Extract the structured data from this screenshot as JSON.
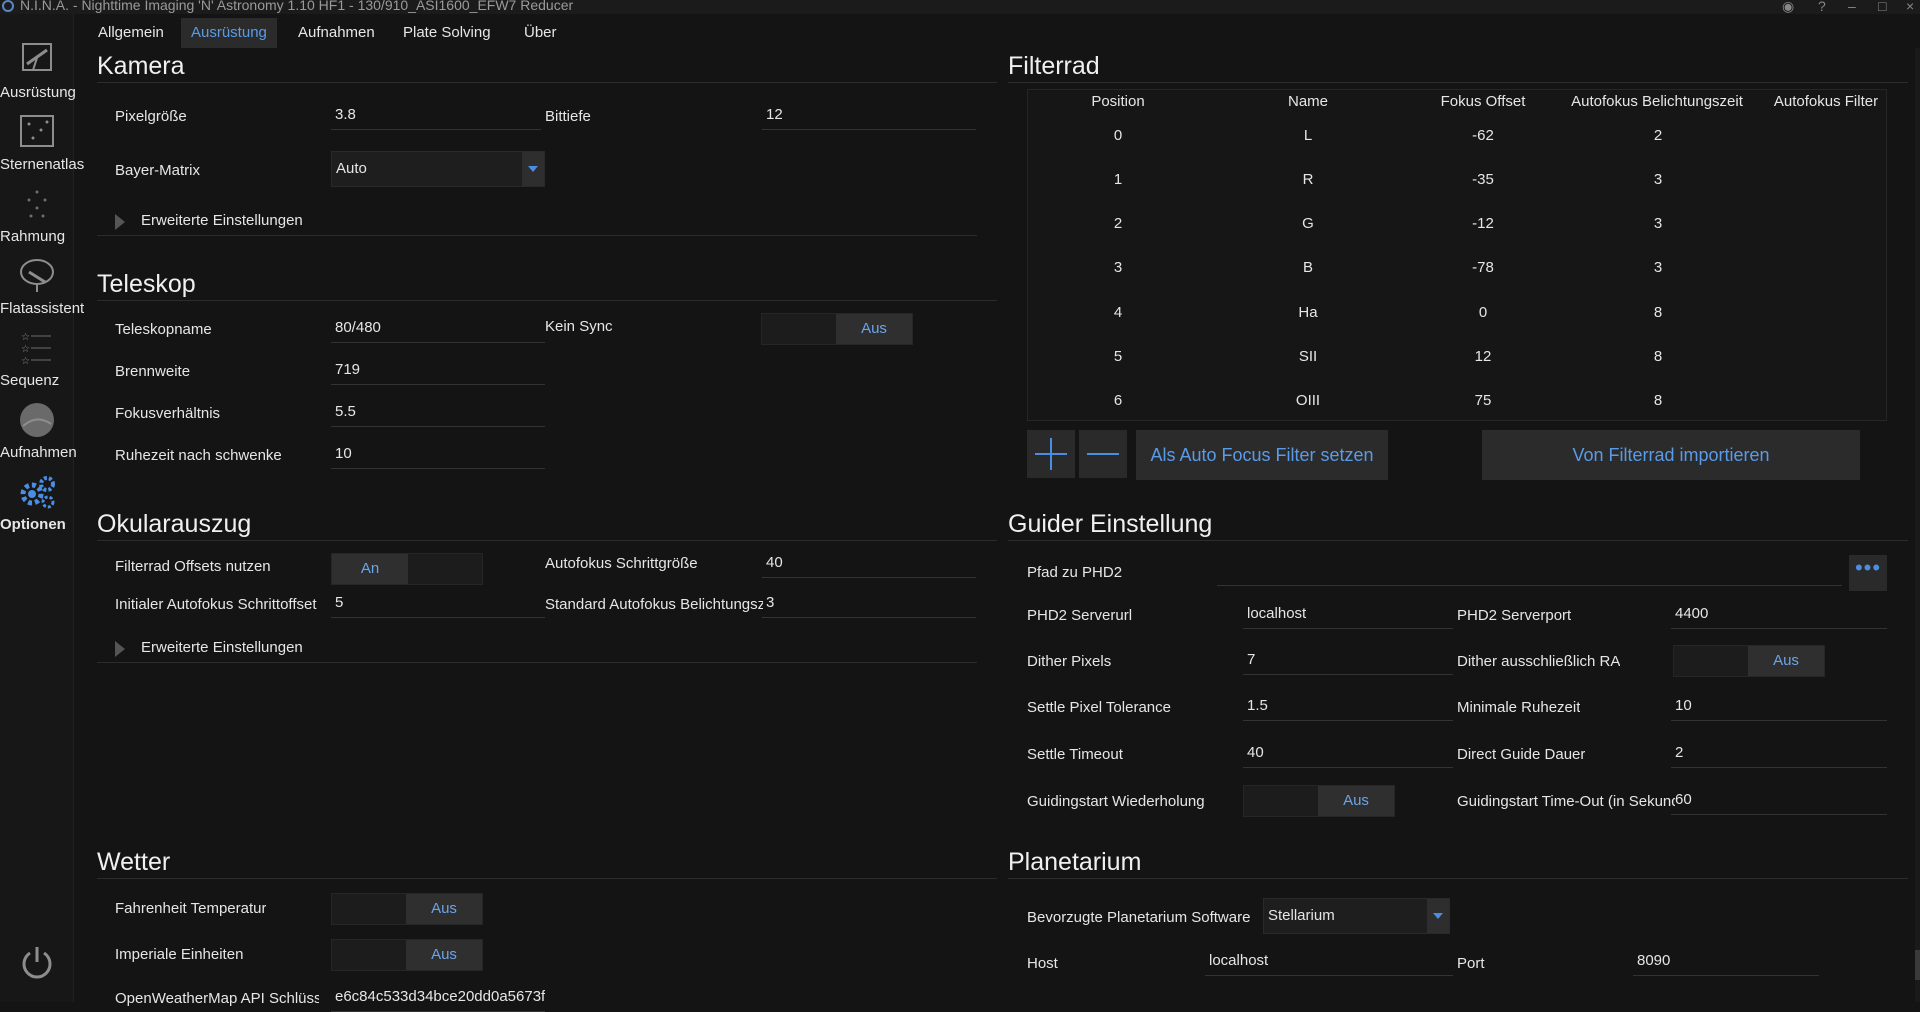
{
  "window": {
    "title": "N.I.N.A. - Nighttime Imaging 'N' Astronomy 1.10 HF1   -  130/910_ASI1600_EFW7 Reducer"
  },
  "sidebar": {
    "items": [
      {
        "label": "Ausrüstung",
        "icon": "telescope-icon"
      },
      {
        "label": "Sternenatlas",
        "icon": "star-map-icon"
      },
      {
        "label": "Rahmung",
        "icon": "framing-icon"
      },
      {
        "label": "Flatassistent",
        "icon": "flat-wizard-icon"
      },
      {
        "label": "Sequenz",
        "icon": "sequence-icon"
      },
      {
        "label": "Aufnahmen",
        "icon": "imaging-icon"
      },
      {
        "label": "Optionen",
        "icon": "gear-icon"
      }
    ],
    "active": "Optionen"
  },
  "tabs": [
    "Allgemein",
    "Ausrüstung",
    "Aufnahmen",
    "Plate Solving",
    "Über"
  ],
  "active_tab": "Ausrüstung",
  "kamera": {
    "title": "Kamera",
    "pixelgroesse_label": "Pixelgröße",
    "pixelgroesse": "3.8",
    "bittiefe_label": "Bittiefe",
    "bittiefe": "12",
    "bayer_label": "Bayer-Matrix",
    "bayer": "Auto",
    "erweitert": "Erweiterte Einstellungen"
  },
  "teleskop": {
    "title": "Teleskop",
    "name_label": "Teleskopname",
    "name": "80/480",
    "sync_label": "Kein Sync",
    "sync": "Aus",
    "brennweite_label": "Brennweite",
    "brennweite": "719",
    "fokus_label": "Fokusverhältnis",
    "fokus": "5.5",
    "ruhezeit_label": "Ruhezeit nach schwenken",
    "ruhezeit": "10"
  },
  "okular": {
    "title": "Okularauszug",
    "offsets_label": "Filterrad Offsets nutzen",
    "offsets": "An",
    "schritt_label": "Autofokus Schrittgröße",
    "schritt": "40",
    "initial_label": "Initialer Autofokus Schrittoffset",
    "initial": "5",
    "belichtung_label": "Standard Autofokus Belichtungszeit",
    "belichtung": "3",
    "erweitert": "Erweiterte Einstellungen"
  },
  "wetter": {
    "title": "Wetter",
    "fahrenheit_label": "Fahrenheit Temperatur",
    "fahrenheit": "Aus",
    "imperial_label": "Imperiale Einheiten",
    "imperial": "Aus",
    "api_label": "OpenWeatherMap API Schlüssel",
    "api": "e6c84c533d34bce20dd0a5673f"
  },
  "filterrad": {
    "title": "Filterrad",
    "columns": [
      "Position",
      "Name",
      "Fokus Offset",
      "Autofokus Belichtungszeit",
      "Autofokus Filter"
    ],
    "rows": [
      [
        "0",
        "L",
        "-62",
        "2",
        ""
      ],
      [
        "1",
        "R",
        "-35",
        "3",
        ""
      ],
      [
        "2",
        "G",
        "-12",
        "3",
        ""
      ],
      [
        "3",
        "B",
        "-78",
        "3",
        ""
      ],
      [
        "4",
        "Ha",
        "0",
        "8",
        ""
      ],
      [
        "5",
        "SII",
        "12",
        "8",
        ""
      ],
      [
        "6",
        "OIII",
        "75",
        "8",
        ""
      ]
    ],
    "set_af_button": "Als Auto Focus Filter setzen",
    "import_button": "Von Filterrad importieren"
  },
  "guider": {
    "title": "Guider Einstellung",
    "pfad_label": "Pfad zu PHD2",
    "pfad": "",
    "serverurl_label": "PHD2 Serverurl",
    "serverurl": "localhost",
    "serverport_label": "PHD2 Serverport",
    "serverport": "4400",
    "dither_label": "Dither Pixels",
    "dither": "7",
    "dither_ra_label": "Dither ausschließlich RA",
    "dither_ra": "Aus",
    "settle_tol_label": "Settle Pixel Tolerance",
    "settle_tol": "1.5",
    "min_ruhe_label": "Minimale Ruhezeit",
    "min_ruhe": "10",
    "settle_timeout_label": "Settle Timeout",
    "settle_timeout": "40",
    "direct_label": "Direct Guide Dauer",
    "direct": "2",
    "wiederholung_label": "Guidingstart Wiederholung",
    "wiederholung": "Aus",
    "timeout_label": "Guidingstart Time-Out (in Sekunden)",
    "timeout": "60"
  },
  "planetarium": {
    "title": "Planetarium",
    "software_label": "Bevorzugte Planetarium Software",
    "software": "Stellarium",
    "host_label": "Host",
    "host": "localhost",
    "port_label": "Port",
    "port": "8090"
  }
}
